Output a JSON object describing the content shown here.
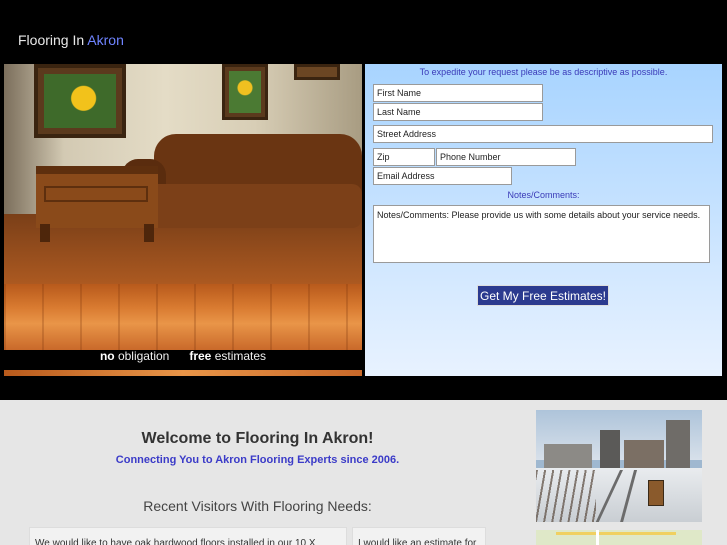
{
  "header": {
    "title_part1": "Flooring In",
    "title_part2": "Akron"
  },
  "hero": {
    "tagline_bold1": "no",
    "tagline_text1": "obligation",
    "tagline_bold2": "free",
    "tagline_text2": "estimates"
  },
  "form": {
    "intro": "To expedite your request please be as descriptive as possible.",
    "first_name": "First Name",
    "last_name": "Last Name",
    "street_address": "Street Address",
    "zip": "Zip",
    "phone": "Phone Number",
    "email": "Email Address",
    "notes_label": "Notes/Comments:",
    "notes_text": "Notes/Comments: Please provide us with some details about your service needs.",
    "submit_label": "Get My Free Estimates!"
  },
  "welcome": {
    "title": "Welcome to Flooring In Akron!",
    "subtitle": "Connecting You to Akron Flooring Experts since 2006.",
    "recent_heading": "Recent Visitors With Flooring Needs:",
    "visitors": [
      {
        "text": "We would like to have oak hardwood floors installed in our 10 X"
      },
      {
        "text": "I would like an estimate for"
      }
    ]
  }
}
